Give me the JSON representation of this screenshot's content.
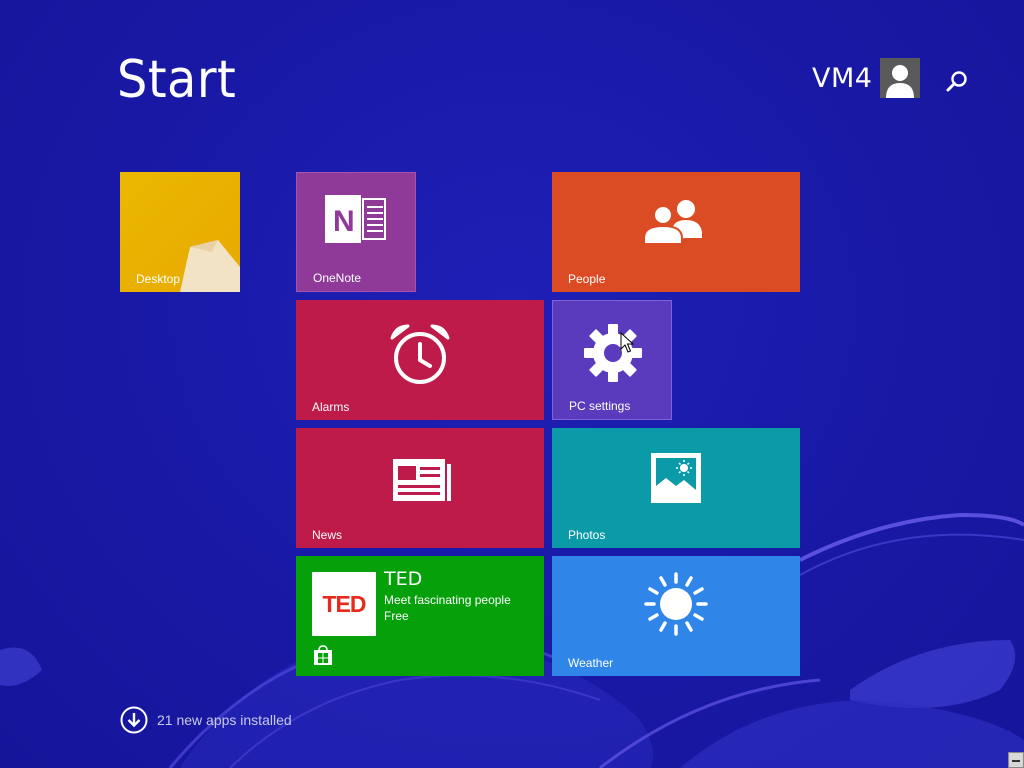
{
  "header": {
    "title": "Start",
    "user_name": "VM4"
  },
  "tiles": {
    "desktop": {
      "label": "Desktop",
      "color": "#eab800"
    },
    "onenote": {
      "label": "OneNote",
      "color": "#8f3a98",
      "icon_text": "N"
    },
    "people": {
      "label": "People",
      "color": "#dc4c24"
    },
    "alarms": {
      "label": "Alarms",
      "color": "#be1a4a"
    },
    "pc_settings": {
      "label": "PC settings",
      "color": "#5b3bbd"
    },
    "news": {
      "label": "News",
      "color": "#be1a4a"
    },
    "photos": {
      "label": "Photos",
      "color": "#0b9aa8"
    },
    "ted": {
      "logo": "TED",
      "title": "TED",
      "description": "Meet fascinating people",
      "price": "Free",
      "color": "#06a10a"
    },
    "weather": {
      "label": "Weather",
      "color": "#2f86e8"
    }
  },
  "footer": {
    "apps_installed": "21 new apps installed"
  },
  "icons": {
    "search": "search-icon",
    "avatar": "user-avatar-icon",
    "people": "people-icon",
    "alarm": "alarm-clock-icon",
    "settings": "gear-icon",
    "news": "newspaper-icon",
    "photos": "photo-icon",
    "weather": "sun-icon",
    "store": "store-icon",
    "apps": "down-arrow-circle-icon"
  },
  "colors": {
    "background": "#1a1aa8",
    "accent_swirl": "#5b4fe0"
  }
}
